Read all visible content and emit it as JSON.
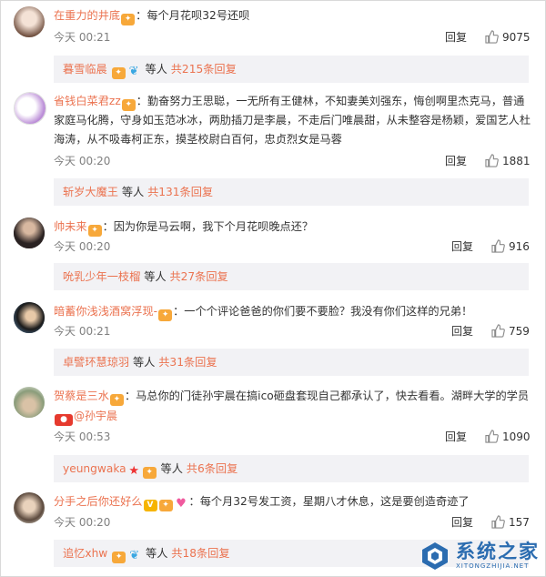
{
  "comments": [
    {
      "user": "在重力的井底",
      "sep": "：",
      "text_lines": [
        "每个月花呗32号还呗"
      ],
      "time": "今天 00:21",
      "reply_label": "回复",
      "likes": "9075",
      "sub_user": "暮雪临晨",
      "sub_mid": "等人",
      "sub_count": "共215条回复"
    },
    {
      "user": "省钱白菜君zz",
      "sep": "：",
      "text_lines": [
        "勤奋努力王思聪，一无所有王健林，不知妻美刘强东，悔创啊里杰克马，普通",
        "家庭马化腾，守身如玉范冰冰，两肋插刀是李晨，不走后门唯晨甜，从未整容是杨颖，爱国艺人杜",
        "海涛，从不吸毒柯正东，摸茎校尉白百何，忠贞烈女是马蓉"
      ],
      "time": "今天 00:20",
      "reply_label": "回复",
      "likes": "1881",
      "sub_user": "斩岁大魔王",
      "sub_mid": "等人",
      "sub_count": "共131条回复"
    },
    {
      "user": "帅未来",
      "sep": "：",
      "text_lines": [
        "因为你是马云啊，我下个月花呗晚点还？"
      ],
      "time": "今天 00:20",
      "reply_label": "回复",
      "likes": "916",
      "sub_user": "吮乳少年一枝榴",
      "sub_mid": "等人",
      "sub_count": "共27条回复"
    },
    {
      "user": "暗蓄你浅浅酒窝浮现-",
      "sep": "：",
      "text_lines": [
        "一个个评论爸爸的你们要不要脸？我没有你们这样的兄弟！"
      ],
      "time": "今天 00:21",
      "reply_label": "回复",
      "likes": "759",
      "sub_user": "卓譬环慧琼羽",
      "sub_mid": "等人",
      "sub_count": "共31条回复"
    },
    {
      "user": "贺蔡是三水",
      "sep": "：",
      "text_lines": [
        "马总你的门徒孙宇晨在搞ico砸盘套现自己都承认了，快去看看。湖畔大学的学员"
      ],
      "mention": "@孙宇晨",
      "time": "今天 00:53",
      "reply_label": "回复",
      "likes": "1090",
      "sub_user": "yeungwaka",
      "sub_mid": "等人",
      "sub_count": "共6条回复"
    },
    {
      "user": "分手之后你还好么",
      "sep": "：",
      "text_lines": [
        "每个月32号发工资，星期八才休息，这是要创造奇迹了"
      ],
      "time": "今天 00:20",
      "reply_label": "回复",
      "likes": "157",
      "sub_user": "追忆xhw",
      "sub_mid": "等人",
      "sub_count": "共18条回复"
    }
  ],
  "icons": {
    "like": "thumbs-up-icon",
    "vip": "vip-badge-icon",
    "heart": "heart-icon",
    "star": "star-icon"
  },
  "colors": {
    "username": "#eb7350",
    "meta": "#808080",
    "subbox_bg": "#f2f2f5",
    "watermark": "#2b6cb0"
  },
  "watermark": {
    "cn": "系统之家",
    "en": "XITONGZHIJIA.NET"
  }
}
